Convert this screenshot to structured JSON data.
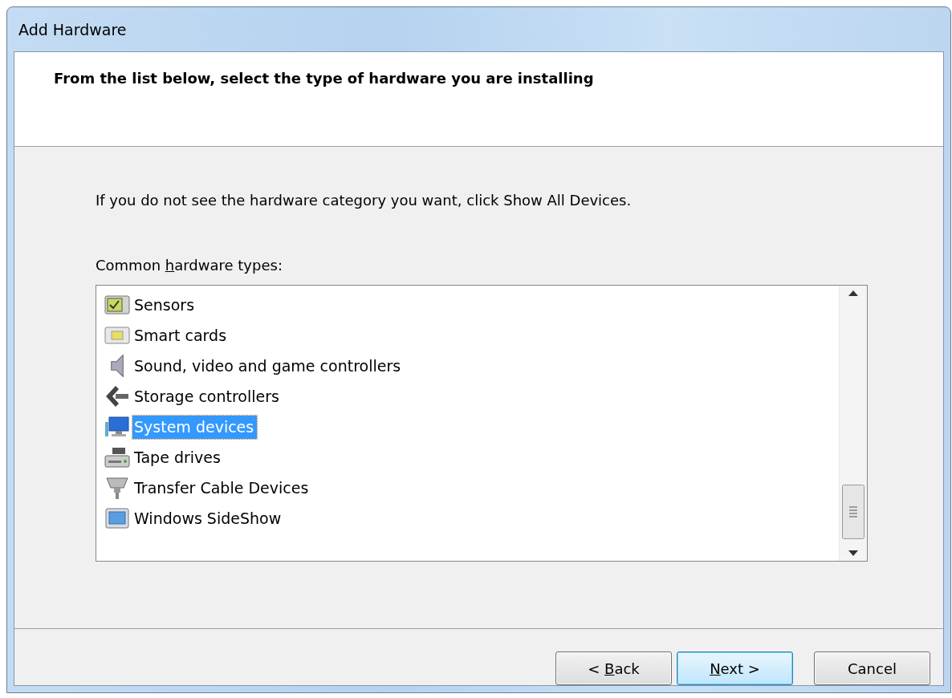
{
  "window": {
    "title": "Add Hardware"
  },
  "header": {
    "heading": "From the list below, select the type of hardware you are installing"
  },
  "intro": "If you do not see the hardware category you want, click Show All Devices.",
  "list_label": {
    "before": "Common ",
    "key": "h",
    "after": "ardware types:"
  },
  "hardware_types": [
    {
      "label": "Sensors",
      "selected": false
    },
    {
      "label": "Smart cards",
      "selected": false
    },
    {
      "label": "Sound, video and game controllers",
      "selected": false
    },
    {
      "label": "Storage controllers",
      "selected": false
    },
    {
      "label": "System devices",
      "selected": true
    },
    {
      "label": "Tape drives",
      "selected": false
    },
    {
      "label": "Transfer Cable Devices",
      "selected": false
    },
    {
      "label": "Windows SideShow",
      "selected": false
    }
  ],
  "buttons": [
    {
      "before": "< ",
      "key": "B",
      "after": "ack",
      "default": false
    },
    {
      "key": "N",
      "after": "ext >",
      "default": true
    },
    {
      "before": "Cancel",
      "default": false
    }
  ]
}
